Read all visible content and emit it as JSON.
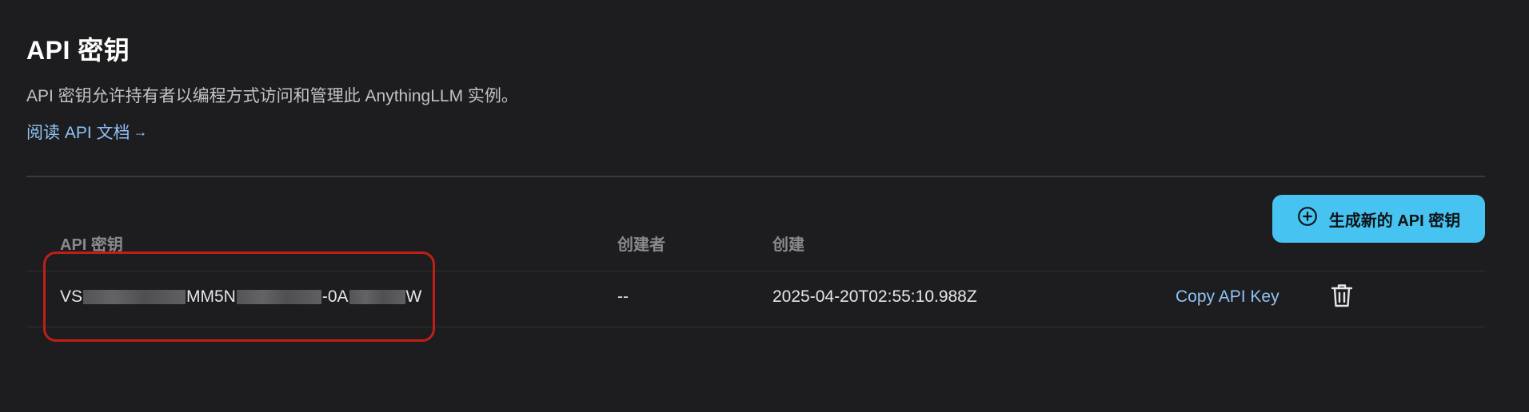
{
  "header": {
    "title": "API 密钥",
    "description": "API 密钥允许持有者以编程方式访问和管理此 AnythingLLM 实例。",
    "docs_link": "阅读 API 文档",
    "docs_arrow": "→"
  },
  "actions": {
    "generate_label": "生成新的 API 密钥",
    "generate_icon": "plus-circle-icon"
  },
  "table": {
    "columns": [
      "API 密钥",
      "创建者",
      "创建"
    ],
    "rows": [
      {
        "key_parts": [
          "VS",
          "MM5N",
          "-0A",
          "W"
        ],
        "creator": "--",
        "created": "2025-04-20T02:55:10.988Z",
        "copy_label": "Copy API Key",
        "delete_icon": "trash-icon"
      }
    ]
  },
  "colors": {
    "background": "#1d1d1f",
    "accent": "#46c3f0",
    "link": "#8fc2f5",
    "highlight": "#c11e16"
  }
}
